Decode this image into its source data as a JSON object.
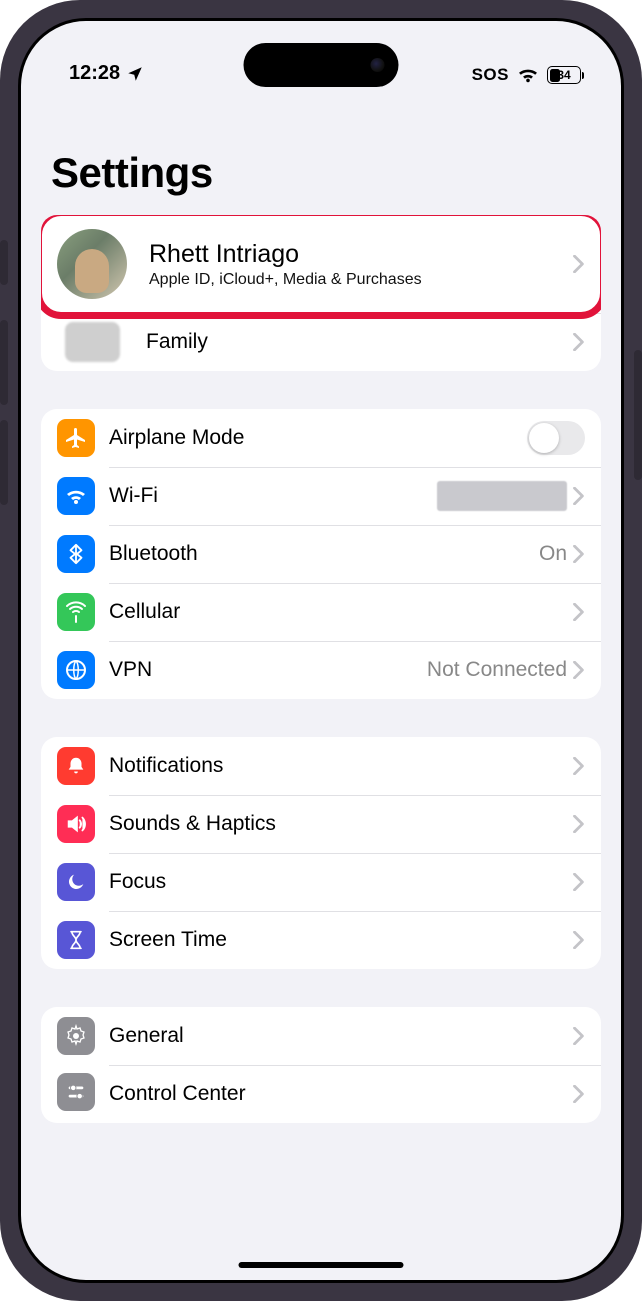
{
  "status": {
    "time": "12:28",
    "sos": "SOS",
    "battery": "34"
  },
  "title": "Settings",
  "profile": {
    "name": "Rhett Intriago",
    "subtitle": "Apple ID, iCloud+, Media & Purchases"
  },
  "family": {
    "label": "Family"
  },
  "network": {
    "airplane": "Airplane Mode",
    "wifi": {
      "label": "Wi-Fi",
      "status": ""
    },
    "bluetooth": {
      "label": "Bluetooth",
      "status": "On"
    },
    "cellular": {
      "label": "Cellular"
    },
    "vpn": {
      "label": "VPN",
      "status": "Not Connected"
    }
  },
  "system": {
    "notifications": "Notifications",
    "sounds": "Sounds & Haptics",
    "focus": "Focus",
    "screentime": "Screen Time"
  },
  "general_group": {
    "general": "General",
    "control_center": "Control Center"
  }
}
